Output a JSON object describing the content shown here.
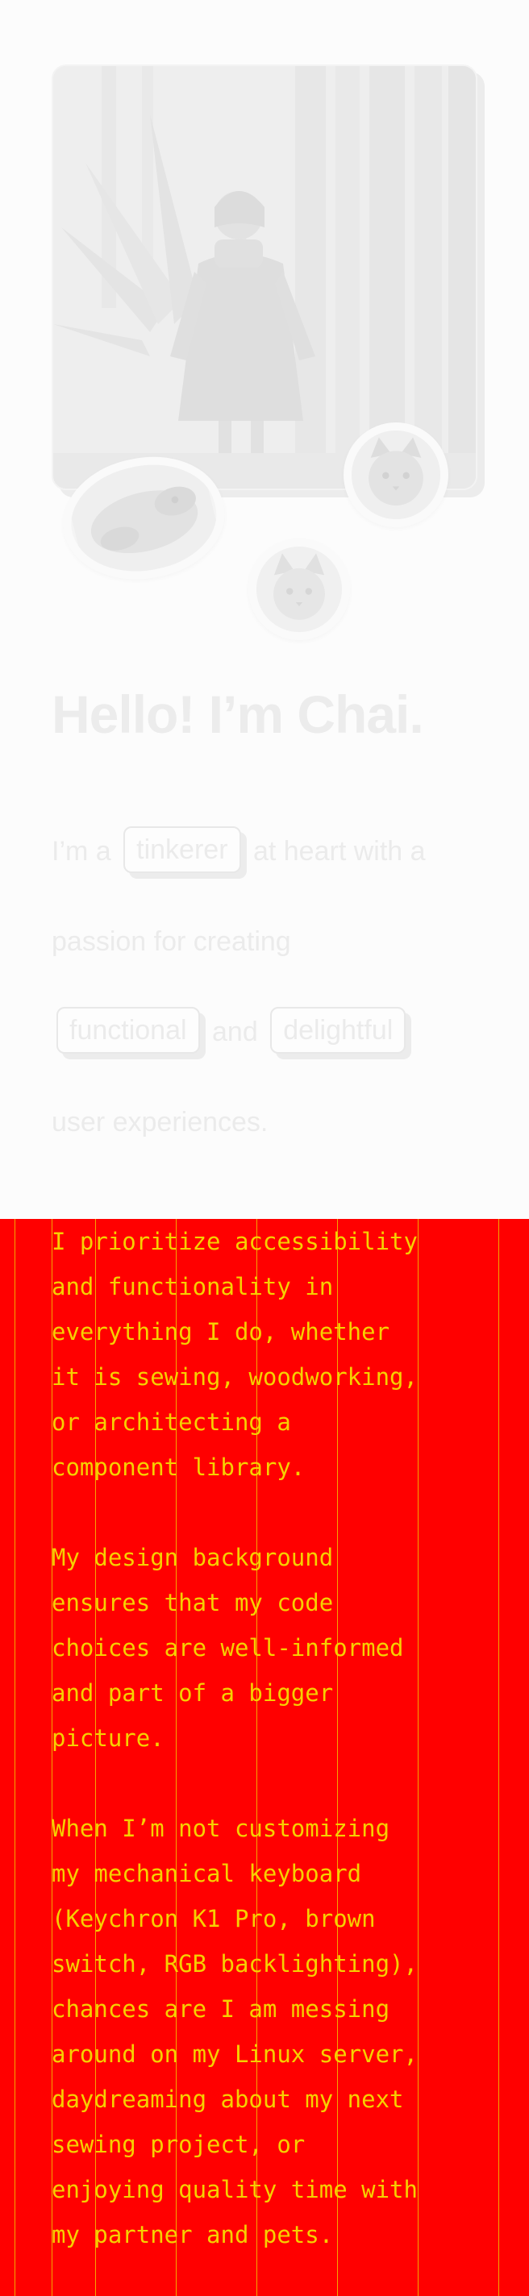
{
  "hero": {
    "photo_alt": "Portrait photo",
    "pets": {
      "dog": "dog-sticker",
      "cat_one": "cat-sticker",
      "cat_two": "cat-sticker"
    }
  },
  "headline": "Hello! I’m Chai.",
  "intro": {
    "part1": "I’m a",
    "pill1": "tinkerer",
    "part2": "at heart with a passion for creating",
    "pill2": "functional",
    "part3": "and",
    "pill3": "delightful",
    "part4": "user experiences."
  },
  "about": {
    "p1": "I prioritize accessibility\nand functionality in\neverything I do, whether\nit is sewing, woodworking,\nor architecting a\ncomponent library.",
    "p2": "My design background\nensures that my code\nchoices are well-informed\nand part of a bigger\npicture.",
    "p3": "When I’m not customizing\nmy mechanical keyboard\n(Keychron K1 Pro, brown\nswitch, RGB backlighting),\nchances are I am messing\naround on my Linux server,\ndaydreaming about my next\nsewing project, or\nenjoying quality time with\nmy partner and pets."
  },
  "colors": {
    "panel_bg": "#ff0000",
    "panel_text": "#f6d000"
  }
}
